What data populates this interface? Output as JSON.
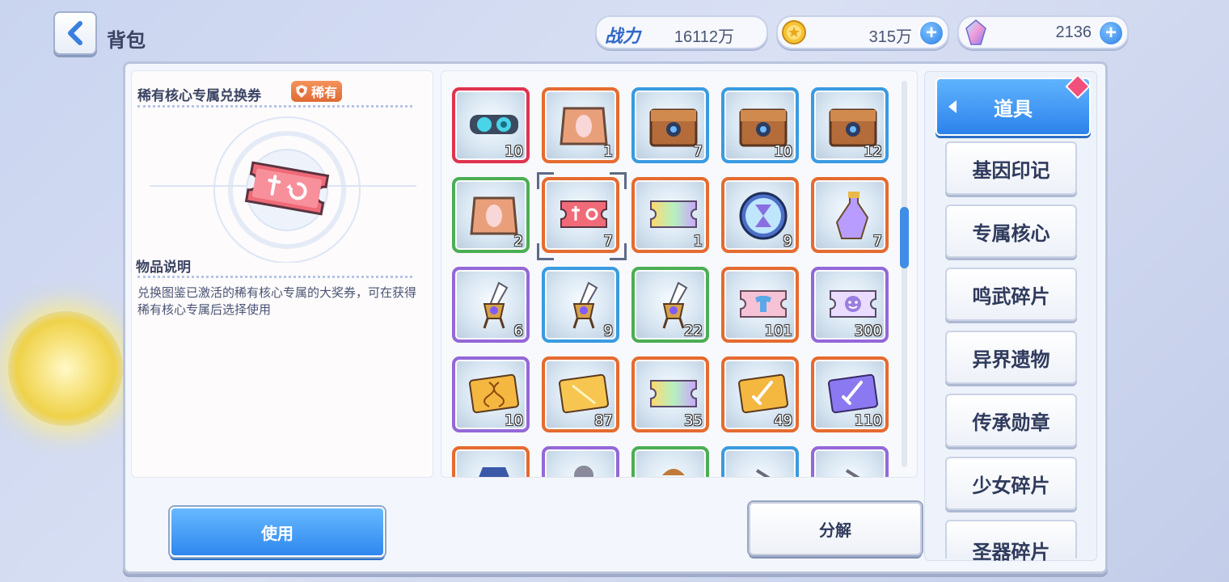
{
  "header": {
    "title": "背包",
    "power_label": "战力",
    "power_value": "16112万",
    "gold_value": "315万",
    "gem_value": "2136"
  },
  "detail": {
    "item_name": "稀有核心专属兑换券",
    "rarity": "稀有",
    "desc_title": "物品说明",
    "desc_text": "兑换图鉴已激活的稀有核心专属的大奖券，可在获得稀有核心专属后选择使用"
  },
  "grid": {
    "items": [
      {
        "qty": "10",
        "frame": "red",
        "icon": "goggles-icon"
      },
      {
        "qty": "1",
        "frame": "orange",
        "icon": "orange-box-icon"
      },
      {
        "qty": "7",
        "frame": "blue",
        "icon": "wood-chest-icon"
      },
      {
        "qty": "10",
        "frame": "blue",
        "icon": "wood-chest-icon"
      },
      {
        "qty": "12",
        "frame": "blue",
        "icon": "wood-chest-icon"
      },
      {
        "qty": "2",
        "frame": "green",
        "icon": "orange-box-icon"
      },
      {
        "qty": "7",
        "frame": "orange",
        "icon": "red-ticket-icon"
      },
      {
        "qty": "1",
        "frame": "orange",
        "icon": "rainbow-ticket-icon"
      },
      {
        "qty": "9",
        "frame": "orange",
        "icon": "hourglass-orb-icon"
      },
      {
        "qty": "7",
        "frame": "orange",
        "icon": "potion-bottle-icon"
      },
      {
        "qty": "6",
        "frame": "purple",
        "icon": "quill-crest-icon"
      },
      {
        "qty": "9",
        "frame": "blue",
        "icon": "quill-crest-icon"
      },
      {
        "qty": "22",
        "frame": "green",
        "icon": "quill-crest-icon"
      },
      {
        "qty": "101",
        "frame": "orange",
        "icon": "pink-shirt-ticket-icon"
      },
      {
        "qty": "300",
        "frame": "purple",
        "icon": "smile-ticket-icon"
      },
      {
        "qty": "10",
        "frame": "purple",
        "icon": "dna-card-icon"
      },
      {
        "qty": "87",
        "frame": "orange",
        "icon": "gold-card-icon"
      },
      {
        "qty": "35",
        "frame": "orange",
        "icon": "rainbow-ticket-icon"
      },
      {
        "qty": "49",
        "frame": "orange",
        "icon": "sword-card-icon"
      },
      {
        "qty": "110",
        "frame": "orange",
        "icon": "sword-card-purple-icon"
      },
      {
        "qty": "",
        "frame": "orange",
        "icon": "cube-icon"
      },
      {
        "qty": "",
        "frame": "purple",
        "icon": "gear-icon"
      },
      {
        "qty": "",
        "frame": "green",
        "icon": "bag-icon"
      },
      {
        "qty": "",
        "frame": "blue",
        "icon": "item-icon"
      },
      {
        "qty": "",
        "frame": "purple",
        "icon": "item-icon"
      }
    ]
  },
  "categories": {
    "active": "道具",
    "items": [
      "基因印记",
      "专属核心",
      "鸣武碎片",
      "异界遗物",
      "传承勋章",
      "少女碎片",
      "圣器碎片"
    ]
  },
  "buttons": {
    "use": "使用",
    "split": "分解"
  }
}
